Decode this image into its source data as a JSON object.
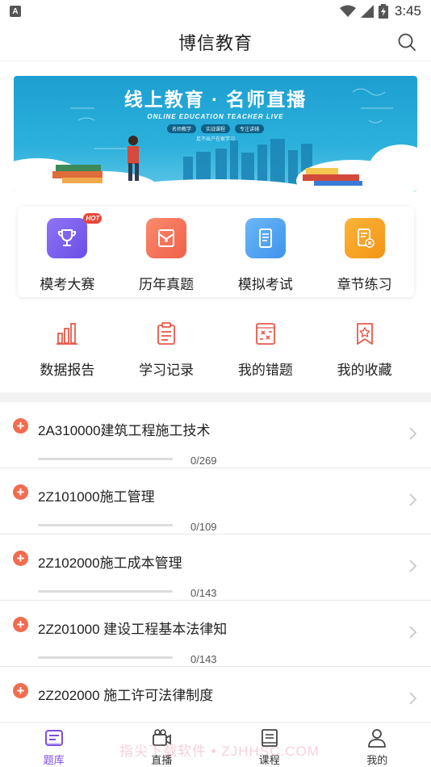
{
  "status_bar": {
    "badge": "A",
    "time": "3:45",
    "icons": [
      "wifi-icon",
      "signal-icon",
      "battery-icon"
    ]
  },
  "header": {
    "title": "博信教育",
    "search_icon": "search-icon"
  },
  "banner": {
    "title": "线上教育 · 名师直播",
    "subtitle": "ONLINE EDUCATION TEACHER LIVE",
    "chips": [
      "名师教学",
      "实战课程",
      "专注讲辅"
    ],
    "tagline": "足不出户在家学习"
  },
  "quick_grid": {
    "items": [
      {
        "label": "模考大赛",
        "icon": "trophy-icon",
        "color": "#7b5cf0",
        "badge": "HOT"
      },
      {
        "label": "历年真题",
        "icon": "envelope-icon",
        "color": "#f5775a"
      },
      {
        "label": "模拟考试",
        "icon": "tablet-icon",
        "color": "#4aa6f2"
      },
      {
        "label": "章节练习",
        "icon": "document-x-icon",
        "color": "#f7a523"
      }
    ]
  },
  "secondary_grid": {
    "items": [
      {
        "label": "数据报告",
        "icon": "bar-chart-icon"
      },
      {
        "label": "学习记录",
        "icon": "clipboard-icon"
      },
      {
        "label": "我的错题",
        "icon": "wrong-book-icon"
      },
      {
        "label": "我的收藏",
        "icon": "bookmark-star-icon"
      }
    ],
    "icon_color": "#e85a4a"
  },
  "chapters": [
    {
      "title": "2A310000建筑工程施工技术",
      "progress": "0/269",
      "done_fraction": 0
    },
    {
      "title": "2Z101000施工管理",
      "progress": "0/109",
      "done_fraction": 0
    },
    {
      "title": "2Z102000施工成本管理",
      "progress": "0/143",
      "done_fraction": 0
    },
    {
      "title": "2Z201000 建设工程基本法律知",
      "progress": "0/143",
      "done_fraction": 0
    },
    {
      "title": "2Z202000 施工许可法律制度",
      "progress": "",
      "done_fraction": 0
    }
  ],
  "bottom_nav": {
    "items": [
      {
        "label": "题库",
        "icon": "question-bank-icon",
        "active": true
      },
      {
        "label": "直播",
        "icon": "video-camera-icon",
        "active": false
      },
      {
        "label": "课程",
        "icon": "book-icon",
        "active": false
      },
      {
        "label": "我的",
        "icon": "user-icon",
        "active": false
      }
    ],
    "active_color": "#7c4ee4"
  },
  "watermark": "指尖下载软件 • ZJHHSC.COM"
}
